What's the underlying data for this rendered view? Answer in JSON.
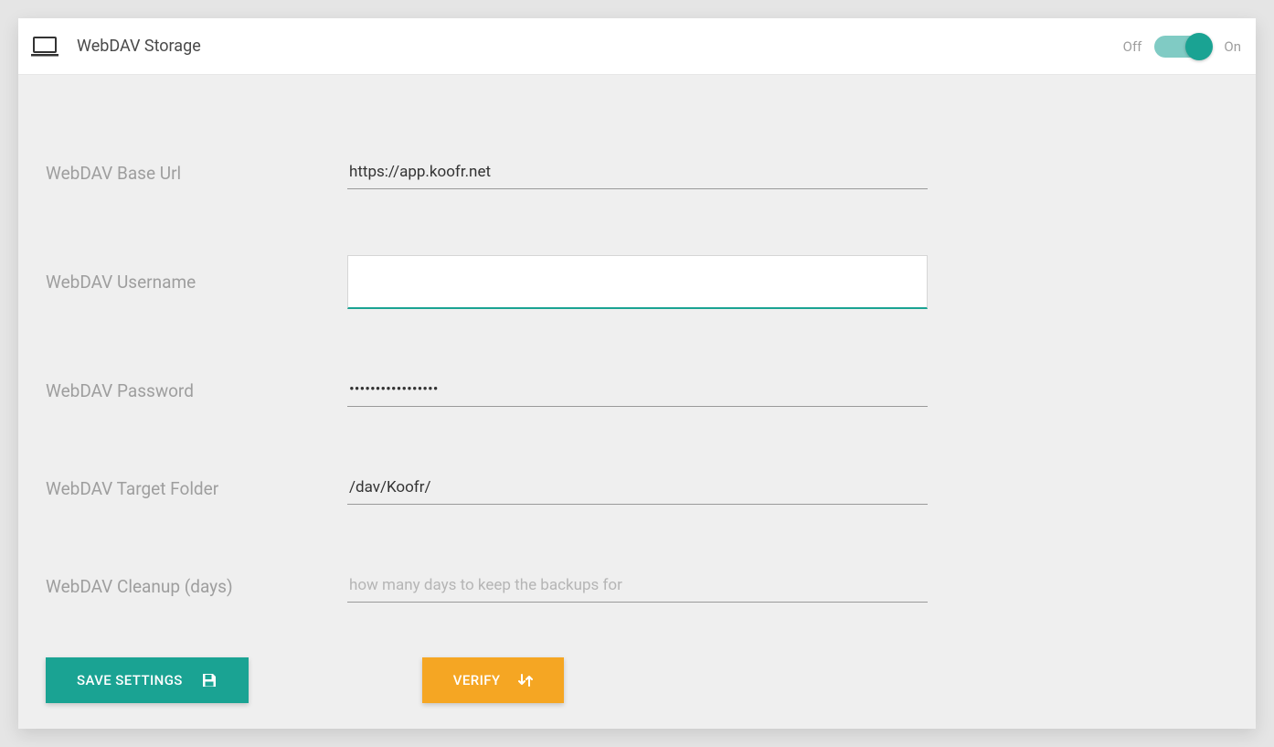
{
  "header": {
    "title": "WebDAV Storage",
    "off_label": "Off",
    "on_label": "On"
  },
  "form": {
    "base_url": {
      "label": "WebDAV Base Url",
      "value": "https://app.koofr.net"
    },
    "username": {
      "label": "WebDAV Username",
      "value": ""
    },
    "password": {
      "label": "WebDAV Password",
      "value": "•••••••••••••••••"
    },
    "target_folder": {
      "label": "WebDAV Target Folder",
      "value": "/dav/Koofr/"
    },
    "cleanup": {
      "label": "WebDAV Cleanup (days)",
      "value": "",
      "placeholder": "how many days to keep the backups for"
    }
  },
  "buttons": {
    "save": "SAVE SETTINGS",
    "verify": "VERIFY"
  }
}
